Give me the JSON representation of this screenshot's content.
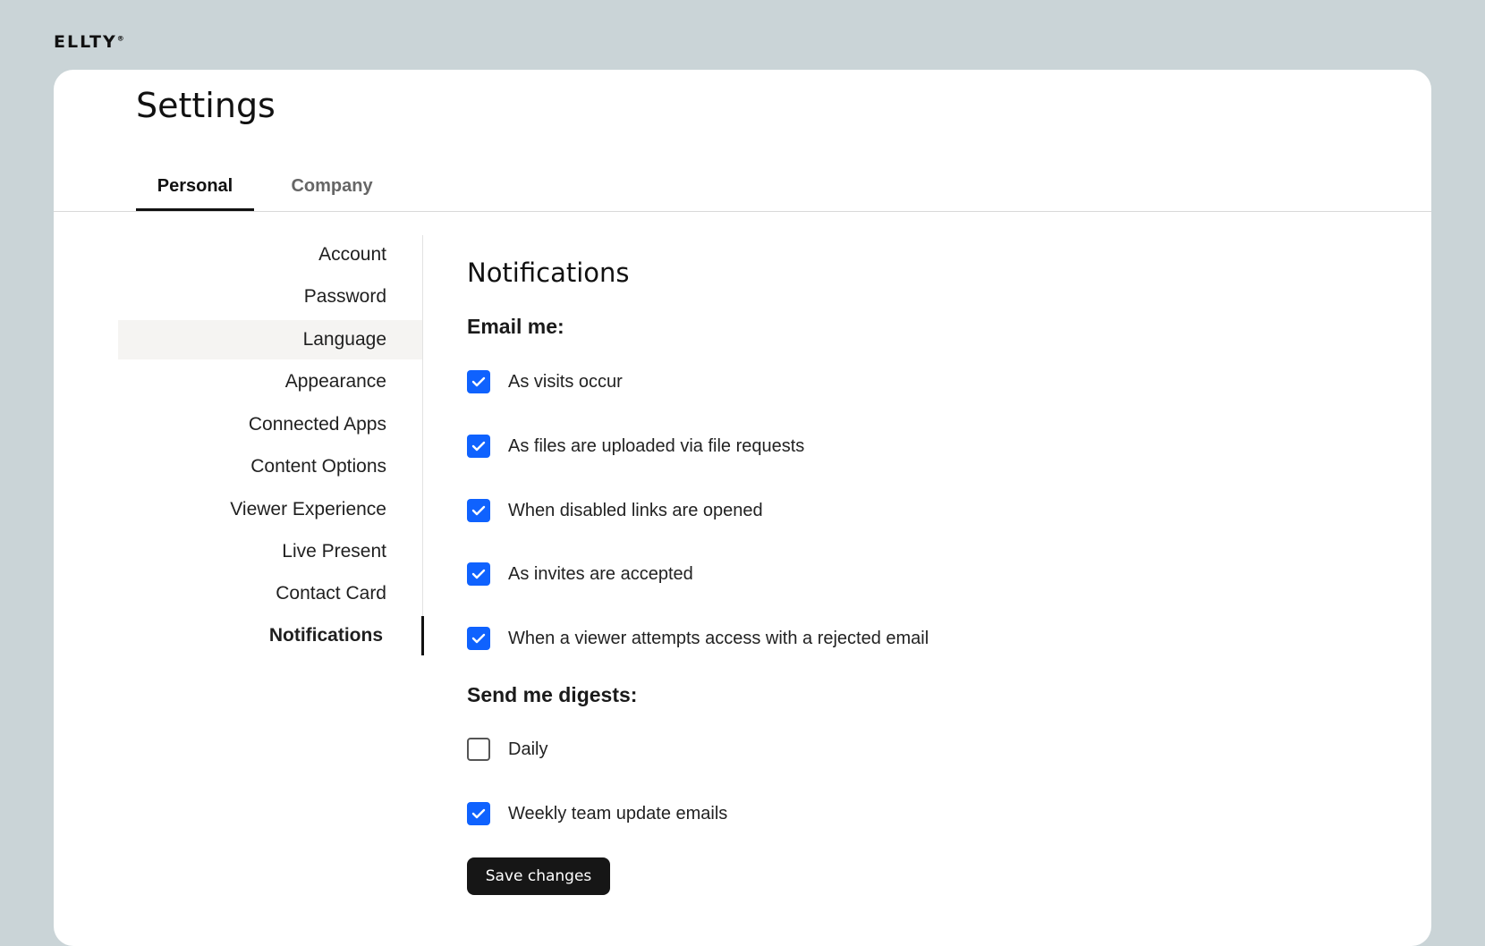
{
  "brand": {
    "logo_text": "ELLTY",
    "logo_mark": "®"
  },
  "page": {
    "title": "Settings"
  },
  "tabs": [
    {
      "label": "Personal",
      "active": true
    },
    {
      "label": "Company",
      "active": false
    }
  ],
  "sidebar": {
    "items": [
      {
        "label": "Account"
      },
      {
        "label": "Password"
      },
      {
        "label": "Language",
        "state": "hover"
      },
      {
        "label": "Appearance"
      },
      {
        "label": "Connected Apps"
      },
      {
        "label": "Content Options"
      },
      {
        "label": "Viewer Experience"
      },
      {
        "label": "Live Present"
      },
      {
        "label": "Contact Card"
      },
      {
        "label": "Notifications",
        "state": "selected"
      }
    ]
  },
  "notifications": {
    "title": "Notifications",
    "email_label": "Email me:",
    "email_options": [
      {
        "label": "As visits occur",
        "checked": true
      },
      {
        "label": "As files are uploaded via file requests",
        "checked": true
      },
      {
        "label": "When disabled links are opened",
        "checked": true
      },
      {
        "label": "As invites are accepted",
        "checked": true
      },
      {
        "label": "When a viewer attempts access with a rejected email",
        "checked": true
      }
    ],
    "digest_label": "Send me digests:",
    "digest_options": [
      {
        "label": "Daily",
        "checked": false
      },
      {
        "label": "Weekly team update emails",
        "checked": true
      }
    ],
    "save_label": "Save changes"
  },
  "colors": {
    "accent": "#0f62fe",
    "background": "#cad4d7",
    "button": "#161616"
  },
  "icons": {
    "checkbox_checked": "check-icon"
  }
}
